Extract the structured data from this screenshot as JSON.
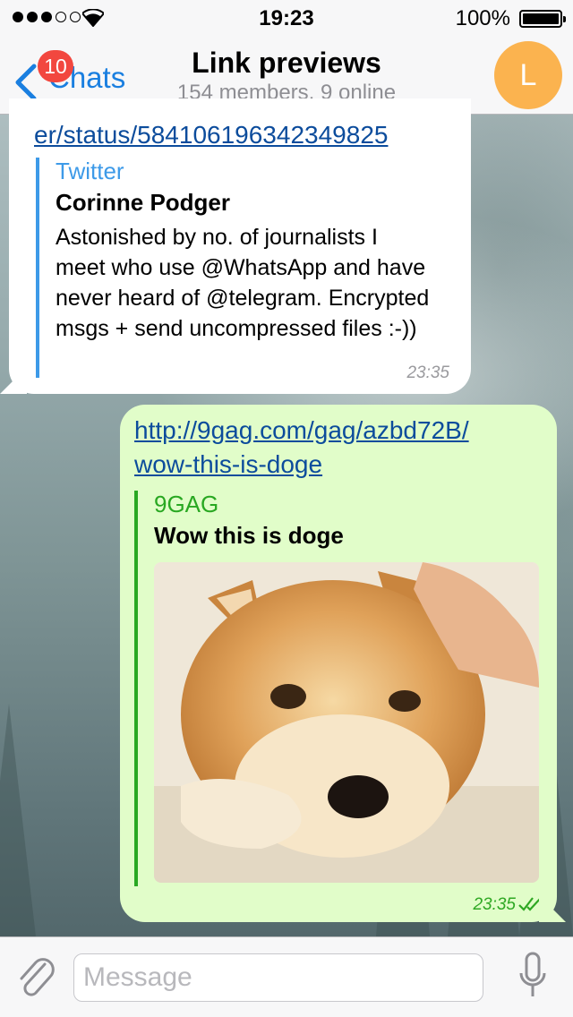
{
  "status_bar": {
    "time": "19:23",
    "battery": "100%",
    "signal_bars_filled": 3,
    "signal_bars_total": 5
  },
  "nav": {
    "back_label": "Chats",
    "unread_badge": "10",
    "title": "Link previews",
    "subtitle": "154 members, 9 online",
    "avatar_letter": "L",
    "avatar_color": "#fbb34f"
  },
  "messages": [
    {
      "direction": "incoming",
      "link_text": "er/status/584106196342349825",
      "preview": {
        "site": "Twitter",
        "site_color": "#3d9ae8",
        "title": "Corinne Podger",
        "text": "Astonished by no. of journalists I meet who use @WhatsApp and have never heard of @telegram. Encrypted msgs + send uncompressed files :-))"
      },
      "time": "23:35"
    },
    {
      "direction": "outgoing",
      "link_line1": "http://9gag.com/gag/azbd72B/",
      "link_line2": "wow-this-is-doge",
      "preview": {
        "site": "9GAG",
        "site_color": "#29a822",
        "title": "Wow this is doge",
        "image_icon": "doge-dog-photo"
      },
      "time": "23:35",
      "read_status_icon": "double-check-icon"
    }
  ],
  "input": {
    "placeholder": "Message",
    "attach_icon": "paperclip-icon",
    "mic_icon": "microphone-icon"
  },
  "colors": {
    "link": "#0c4c9c",
    "outgoing_bubble": "#e1fdc9",
    "incoming_bubble": "#ffffff",
    "accent_blue": "#1a7fe0",
    "badge_red": "#f2473f"
  }
}
